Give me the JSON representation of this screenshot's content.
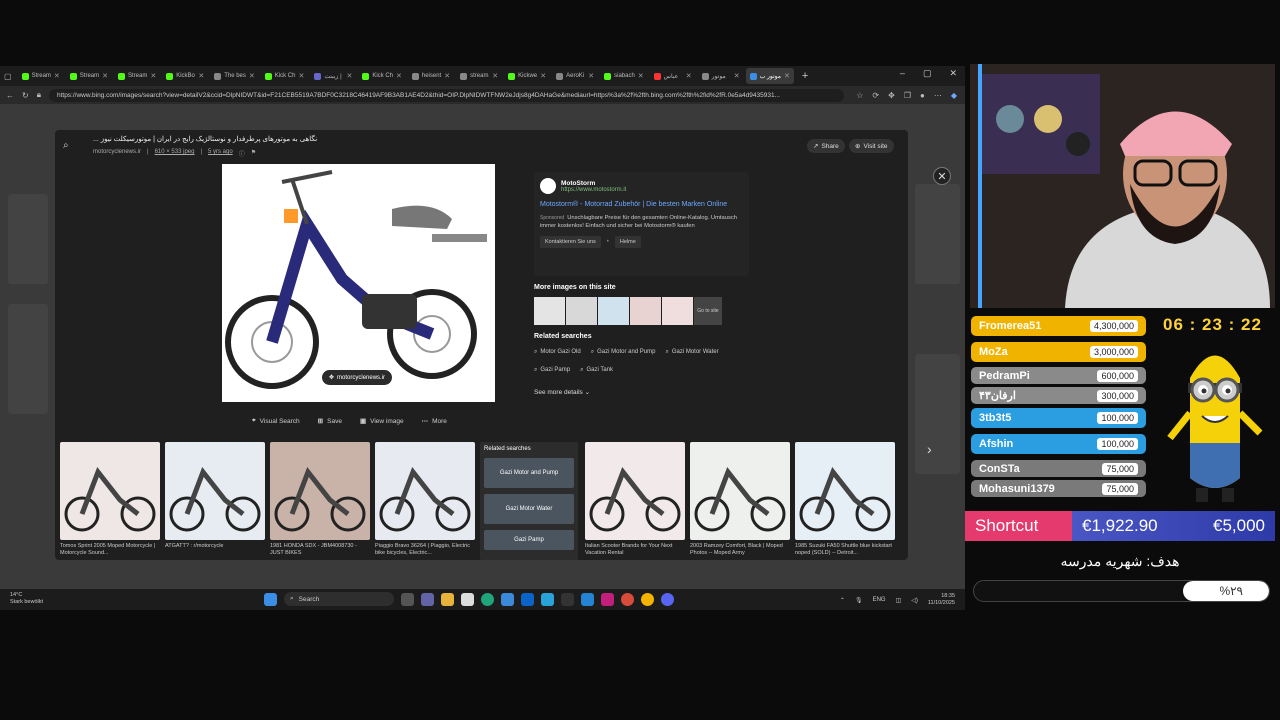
{
  "browser": {
    "tabs": [
      {
        "label": "Stream",
        "color": "#53fc18"
      },
      {
        "label": "Stream",
        "color": "#53fc18"
      },
      {
        "label": "Stream",
        "color": "#53fc18"
      },
      {
        "label": "KickBo",
        "color": "#53fc18"
      },
      {
        "label": "The bes",
        "color": "#888888"
      },
      {
        "label": "Kick Ch",
        "color": "#53fc18"
      },
      {
        "label": "زیبنت |",
        "color": "#6666cc"
      },
      {
        "label": "Kick Ch",
        "color": "#53fc18"
      },
      {
        "label": "heisent",
        "color": "#888888"
      },
      {
        "label": "stream",
        "color": "#888888"
      },
      {
        "label": "Kickwe",
        "color": "#53fc18"
      },
      {
        "label": "AeroKi",
        "color": "#888888"
      },
      {
        "label": "siabach",
        "color": "#53fc18"
      },
      {
        "label": "عباس",
        "color": "#ff3333"
      },
      {
        "label": "موتور",
        "color": "#888888"
      },
      {
        "label": "موتور ب",
        "color": "#3a8ee6"
      }
    ],
    "new_tab": "+",
    "url": "https://www.bing.com/images/search?view=detailV2&ccid=DlpNIDWT&id=F21CEB5519A7BDF0C3218C46419AF9B3AB1AE4D2&thid=OIP.DlpNIDWTFNW2eJdjs8g4DAHaGe&mediaurl=https%3a%2f%2fth.bing.com%2fth%2fid%2fR.0e5a4d9435931..."
  },
  "modal": {
    "title": "... نگاهی به موتورهای پرطرفدار و نوستالژیک رایج در ایران | موتورسیکلت نیوز",
    "source": "motorcyclenews.ir",
    "dims": "610 × 533 jpeg",
    "age": "5 yrs ago",
    "share": "Share",
    "visit": "Visit site",
    "image_badge": "motorcyclenews.ir",
    "actions": [
      "Visual Search",
      "Save",
      "View image",
      "More"
    ],
    "ad": {
      "name": "MotoStorm",
      "url": "https://www.motostorm.it",
      "title": "Motostorm® - Motorrad Zubehör | Die besten Marken Online",
      "sponsored": "Sponsored",
      "desc": "Unschlagbare Preise für den gesamten Online-Katalog. Umtausch immer kostenlos! Einfach und sicher bei Motostorm® kaufen",
      "btn1": "Kontaktieren Sie uns",
      "btn2": "Helme"
    },
    "more_images": "More images on this site",
    "goto_site": "Go to site",
    "related_title": "Related searches",
    "related": [
      "Motor Gazi Old",
      "Gazi Motor and Pump",
      "Gazi Motor Water",
      "Gazi Pamp",
      "Gazi Tank"
    ],
    "see_more": "See more details"
  },
  "grid": [
    {
      "caption": "Tomos Sprint 2005 Moped Motorcycle | Motorcycle Sound..."
    },
    {
      "caption": "ATGATT? : r/motorcycle"
    },
    {
      "caption": "1981 HONDA SDX - JBM4008730 - JUST BIKES"
    },
    {
      "caption": "Piaggio Bravo 36264 | Piaggio, Electric bike bicycles, Electric..."
    },
    {
      "caption": "Italian Scooter Brands for Your Next Vacation Rental"
    },
    {
      "caption": "2003 Ramzey Comfort, Black | Moped Photos -- Moped Army"
    },
    {
      "caption": "1985 Suzuki FA50 Shuttle blue kickstart noped (SOLD) -- Detroit..."
    }
  ],
  "related_box": {
    "title": "Related searches",
    "items": [
      "Gazi Motor and Pump",
      "Gazi Motor Water",
      "Gazi Pamp"
    ]
  },
  "taskbar": {
    "temp": "14°C",
    "weather": "Stark bewölkt",
    "search": "Search",
    "lang": "ENG",
    "time": "18:35",
    "date": "11/10/2025"
  },
  "overlay": {
    "leaderboard": [
      {
        "name": "Fromerea51",
        "value": "4,300,000",
        "color": "#f0b400"
      },
      {
        "name": "MoZa",
        "value": "3,000,000",
        "color": "#f0b400"
      },
      {
        "name": "PedramPi",
        "value": "600,000",
        "color": "#8a8a8a"
      },
      {
        "name": "ارفان۴۳",
        "value": "300,000",
        "color": "#8a8a8a"
      },
      {
        "name": "3tb3t5",
        "value": "100,000",
        "color": "#2a9ee0"
      },
      {
        "name": "Afshin",
        "value": "100,000",
        "color": "#2a9ee0"
      },
      {
        "name": "ConSTa",
        "value": "75,000",
        "color": "#7a7a7a"
      },
      {
        "name": "Mohasuni1379",
        "value": "75,000",
        "color": "#7a7a7a"
      }
    ],
    "timer": "06 : 23 : 22",
    "shortcut_label": "Shortcut",
    "donated": "€1,922.90",
    "target": "€5,000",
    "goal_title": "هدف: شهریه مدرسه",
    "goal_pct_text": "%۲۹",
    "goal_fraction": 0.29
  }
}
